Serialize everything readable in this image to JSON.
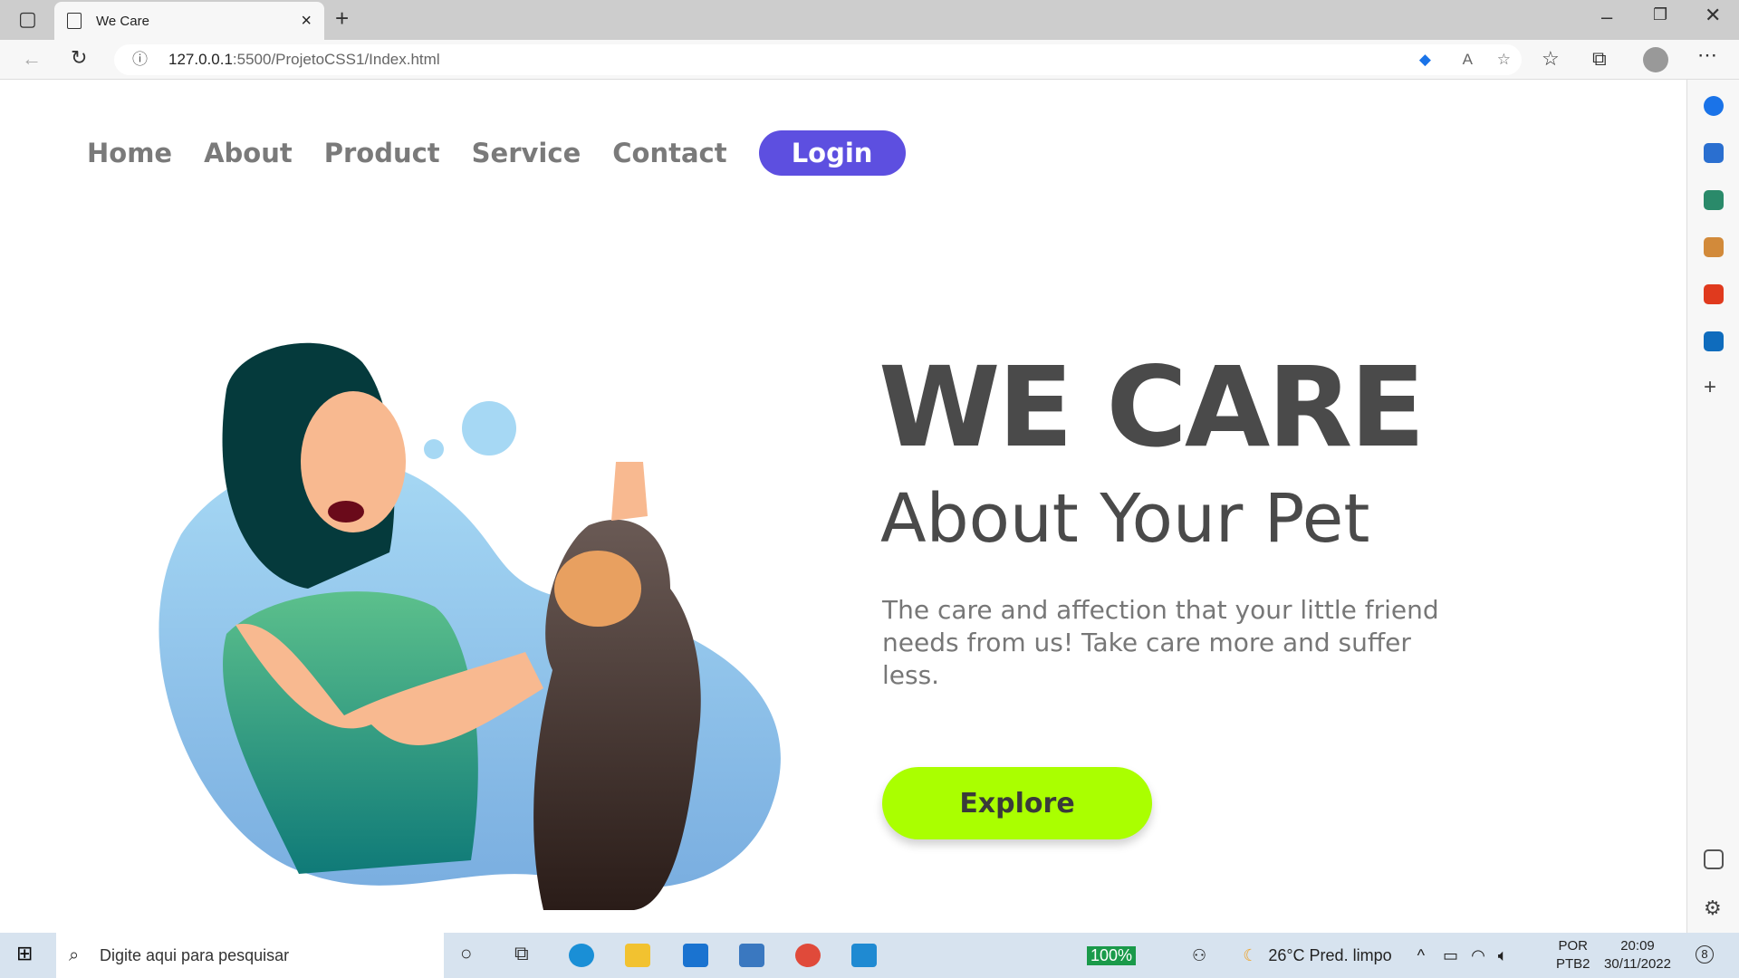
{
  "browser": {
    "tab_title": "We Care",
    "url_host": "127.0.0.1",
    "url_path": ":5500/ProjetoCSS1/Index.html"
  },
  "nav": {
    "items": [
      "Home",
      "About",
      "Product",
      "Service",
      "Contact"
    ],
    "login": "Login"
  },
  "hero": {
    "title": "WE CARE",
    "subtitle": "About Your Pet",
    "description": "The care and affection that your little friend needs from us! Take care more and suffer less.",
    "cta": "Explore"
  },
  "colors": {
    "accent": "#5d4fe0",
    "cta": "#aaff00",
    "text": "#4a4a4a"
  },
  "taskbar": {
    "search_placeholder": "Digite aqui para pesquisar",
    "battery": "100%",
    "weather": "26°C  Pred. limpo",
    "lang1": "POR",
    "lang2": "PTB2",
    "time": "20:09",
    "date": "30/11/2022",
    "notifications": "8"
  }
}
